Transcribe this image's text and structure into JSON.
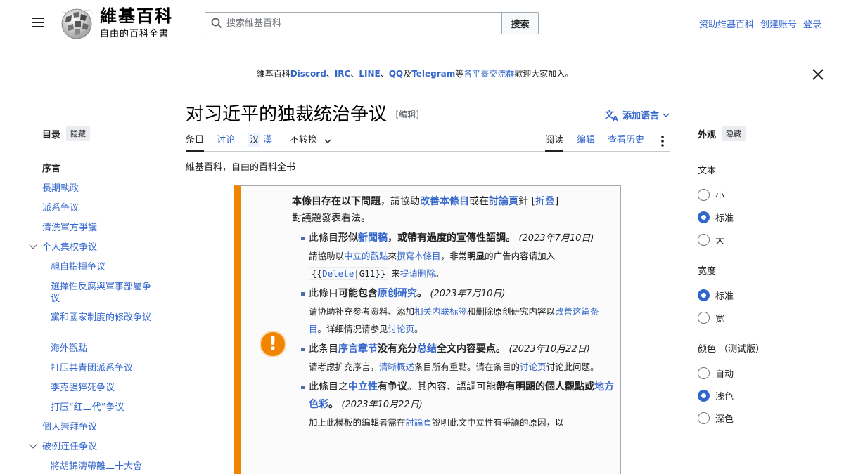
{
  "header": {
    "site_name": "維基百科",
    "site_tagline": "自由的百科全書",
    "search_placeholder": "搜索維基百科",
    "search_button": "搜索",
    "user_links": [
      "资助维基百科",
      "创建账号",
      "登录"
    ]
  },
  "sitenotice": {
    "prefix": "維基百科",
    "items": [
      "Discord",
      "IRC",
      "LINE",
      "QQ",
      "Telegram"
    ],
    "seps": [
      "、",
      "、",
      "、",
      "及",
      ""
    ],
    "middle": "等",
    "link": "各平臺交流群",
    "suffix": "歡迎大家加入。"
  },
  "article": {
    "title": "对习近平的独裁统治争议",
    "edit_label": "[编辑]",
    "add_languages": "添加语言",
    "tagline": "維基百科，自由的百科全书"
  },
  "tabs": {
    "article": "条目",
    "talk": "讨论",
    "variant_hans": "汉",
    "variant_hant": "漢",
    "no_convert": "不转换",
    "read": "阅读",
    "edit": "编辑",
    "history": "查看历史"
  },
  "toc": {
    "title": "目录",
    "hide": "隐藏",
    "items": [
      "序言",
      "長期執政",
      "派系争议",
      "清洗軍方爭議",
      "个人集权争议",
      "親自指揮争议",
      "選擇性反腐與軍事部屬争议",
      "黨和國家制度的修改争议",
      "海外觀點",
      "打压共青团派系争议",
      "李克强猝死争议",
      "打压“红二代”争议",
      "個人崇拜争议",
      "破例连任争议",
      "將胡錦濤帶離二十大會"
    ]
  },
  "appearance": {
    "title": "外观",
    "hide": "隐藏",
    "text": {
      "label": "文本",
      "options": [
        "小",
        "标准",
        "大"
      ],
      "selected": "标准"
    },
    "width": {
      "label": "宽度",
      "options": [
        "标准",
        "宽"
      ],
      "selected": "标准"
    },
    "color": {
      "label": "颜色 （测试版）",
      "options": [
        "自动",
        "浅色",
        "深色"
      ],
      "selected": "浅色"
    }
  },
  "ambox": {
    "header_bold": "本條目存在以下問題",
    "header_mid": "，請協助",
    "header_link1": "改善本條目",
    "header_or": "或在",
    "header_link2": "討論頁",
    "header_tail": "針",
    "collapse": "折叠",
    "header_line2": "對議題發表看法。",
    "issue1": {
      "p1": "此條目",
      "b1": "形似",
      "l1": "新聞稿",
      "b2": "，或帶有過度的宣傳性語調。",
      "date": "(2023年7月10日)",
      "s1": "請協助以",
      "sl1": "中立的觀點",
      "s2": "來",
      "sl2": "撰寫本條目",
      "s3": "，非常",
      "sb": "明显",
      "s4": "的广告内容请加入",
      "code1": "{{",
      "code2": "Delete",
      "code3": "|G11}}",
      "s5": "来",
      "sl3": "提请删除",
      "s6": "。"
    },
    "issue2": {
      "p1": "此條目",
      "b1": "可能包含",
      "l1": "原创研究",
      "b2": "。",
      "date": "(2023年7月10日)",
      "s1": "请协助补充参考资料、添加",
      "sl1": "相关内联标签",
      "s2": "和删除原创研究内容以",
      "sl2": "改善这篇条目",
      "s3": "。详细情况请参见",
      "sl3": "讨论页",
      "s4": "。"
    },
    "issue3": {
      "p1": "此条目",
      "l1": "序言章节",
      "b1": "没有充分",
      "l2": "总结",
      "b2": "全文内容要点。",
      "date": "(2023年10月22日)",
      "s1": "请考虑扩充序言，",
      "sl1": "清晰概述",
      "s2": "条目所有重點。请在条目的",
      "sl2": "讨论页",
      "s3": "讨论此问题。"
    },
    "issue4": {
      "p1": "此條目之",
      "l1": "中立性",
      "b1": "有争议",
      "p2": "。其內容、語調可能",
      "b2": "帶有明顯的個人觀點",
      "b3": "或",
      "l2": "地方色彩",
      "b4": "。",
      "date": "(2023年10月22日)",
      "s1": "加上此模板的編輯者需在",
      "sl1": "討論頁",
      "s2": "說明此文中立性有爭議的原因，以"
    },
    "icon": "!"
  }
}
